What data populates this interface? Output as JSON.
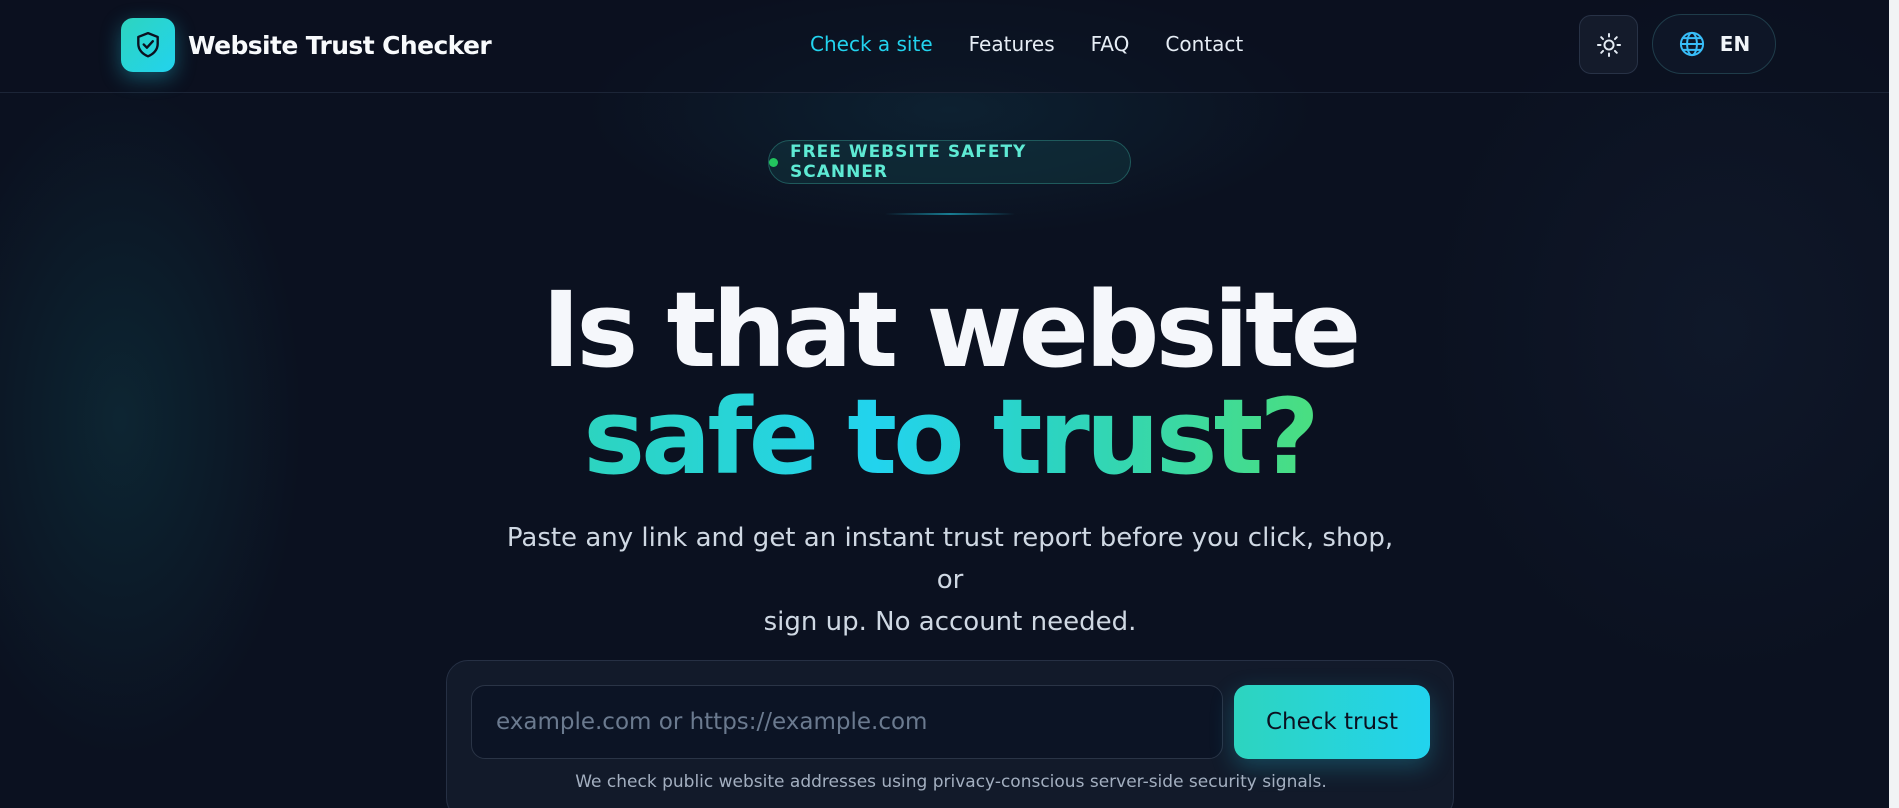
{
  "colors": {
    "background": "#0b1120",
    "accent": "#22d3ee",
    "accent_teal": "#2dd4bf",
    "accent_green": "#4ade80",
    "badge_dot": "#22c55e"
  },
  "header": {
    "brand": {
      "logo_icon": "shield-check-icon",
      "name": "Website Trust Checker"
    },
    "nav": [
      {
        "label": "Check a site",
        "active": true
      },
      {
        "label": "Features",
        "active": false
      },
      {
        "label": "FAQ",
        "active": false
      },
      {
        "label": "Contact",
        "active": false
      }
    ],
    "theme_toggle_icon": "sun-icon",
    "language": {
      "icon": "globe-icon",
      "label": "EN"
    }
  },
  "hero": {
    "badge": "FREE WEBSITE SAFETY SCANNER",
    "headline_line1": "Is that website",
    "headline_line2": "safe to trust?",
    "subtitle_line1": "Paste any link and get an instant trust report before you click, shop, or",
    "subtitle_line2": "sign up. No account needed."
  },
  "search": {
    "placeholder": "example.com or https://example.com",
    "value": "",
    "button_label": "Check trust",
    "note": "We check public website addresses using privacy-conscious server-side security signals."
  }
}
